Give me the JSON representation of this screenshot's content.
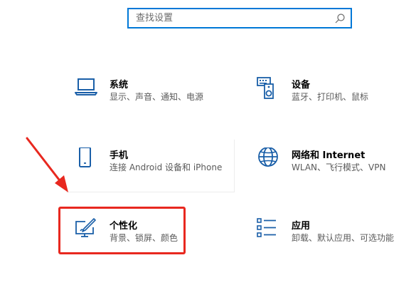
{
  "search": {
    "placeholder": "查找设置",
    "icon": "search-icon"
  },
  "tiles": [
    {
      "id": "system",
      "title": "系统",
      "description": "显示、声音、通知、电源",
      "icon": "laptop-icon"
    },
    {
      "id": "devices",
      "title": "设备",
      "description": "蓝牙、打印机、鼠标",
      "icon": "keyboard-speaker-icon"
    },
    {
      "id": "phone",
      "title": "手机",
      "description": "连接 Android 设备和 iPhone",
      "icon": "phone-icon"
    },
    {
      "id": "network",
      "title": "网络和 Internet",
      "description": "WLAN、飞行模式、VPN",
      "icon": "globe-icon"
    },
    {
      "id": "personalization",
      "title": "个性化",
      "description": "背景、锁屏、颜色",
      "icon": "paintbrush-monitor-icon"
    },
    {
      "id": "apps",
      "title": "应用",
      "description": "卸载、默认应用、可选功能",
      "icon": "app-list-icon"
    }
  ],
  "annotation": {
    "highlight_color": "#e8281f",
    "highlighted_tile": "personalization"
  },
  "colors": {
    "accent": "#0078d7",
    "icon": "#1a5fa8"
  }
}
